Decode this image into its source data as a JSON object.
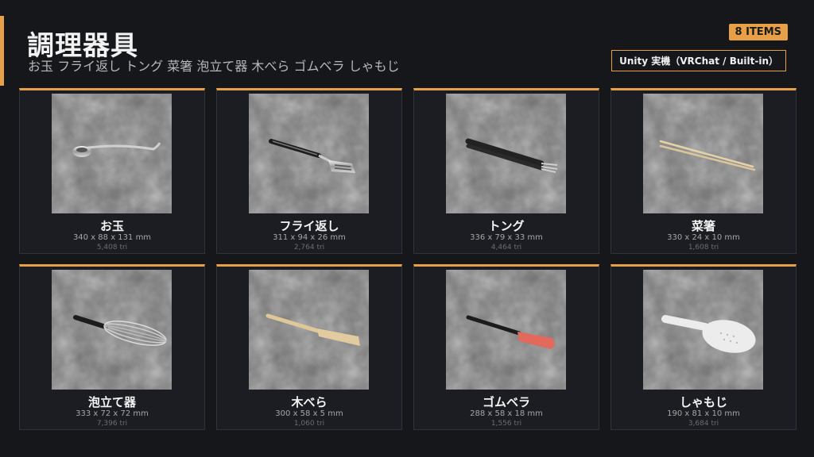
{
  "header": {
    "title": "調理器具",
    "subtitle": "お玉 フライ返し トング 菜箸 泡立て器 木べら ゴムベラ しゃもじ",
    "count_badge": "8 ITEMS",
    "platform_badge": "Unity 実機（VRChat / Built-in）"
  },
  "colors": {
    "accent": "#e8a048",
    "background": "#15171b",
    "card": "#1b1d22"
  },
  "items": [
    {
      "name": "お玉",
      "dims": "340 x 88 x 131 mm",
      "tris": "5,408 tri",
      "icon": "ladle-icon"
    },
    {
      "name": "フライ返し",
      "dims": "311 x 94 x 26 mm",
      "tris": "2,764 tri",
      "icon": "spatula-icon"
    },
    {
      "name": "トング",
      "dims": "336 x 79 x 33 mm",
      "tris": "4,464 tri",
      "icon": "tongs-icon"
    },
    {
      "name": "菜箸",
      "dims": "330 x 24 x 10 mm",
      "tris": "1,608 tri",
      "icon": "chopsticks-icon"
    },
    {
      "name": "泡立て器",
      "dims": "333 x 72 x 72 mm",
      "tris": "7,396 tri",
      "icon": "whisk-icon"
    },
    {
      "name": "木べら",
      "dims": "300 x 58 x 5 mm",
      "tris": "1,060 tri",
      "icon": "wooden-spatula-icon"
    },
    {
      "name": "ゴムベラ",
      "dims": "288 x 58 x 18 mm",
      "tris": "1,556 tri",
      "icon": "rubber-spatula-icon"
    },
    {
      "name": "しゃもじ",
      "dims": "190 x 81 x 10 mm",
      "tris": "3,684 tri",
      "icon": "rice-paddle-icon"
    }
  ]
}
